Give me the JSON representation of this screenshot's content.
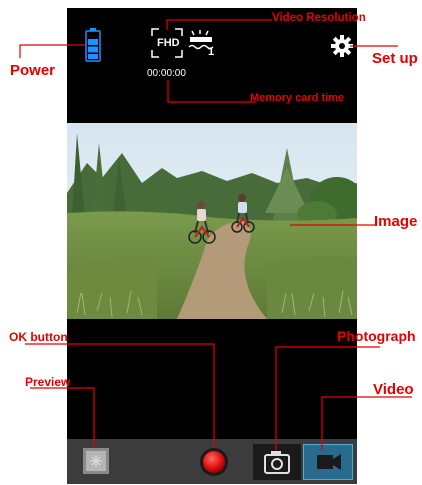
{
  "status": {
    "timer": "00:00:00",
    "resolution": "FHD",
    "white_balance_index": "1"
  },
  "icons": {
    "battery": "battery-icon",
    "resolution": "fhd-resolution-icon",
    "white_balance": "white-balance-icon",
    "settings": "gear-icon",
    "preview": "gallery-thumbnail-icon",
    "record": "record-button-icon",
    "camera": "camera-icon",
    "video": "video-camera-icon"
  },
  "callouts": {
    "power": "Power",
    "video_resolution": "Video Resolution",
    "set_up": "Set up",
    "memory_card_time": "Memory card time",
    "image": "Image",
    "ok_button": "OK button",
    "photograph": "Photograph",
    "preview": "Preview",
    "video": "Video"
  },
  "colors": {
    "callout_red": "#e60000",
    "battery_blue": "#1e90ff",
    "record_red": "#e01010",
    "video_tab_highlight": "#2a6a8c"
  }
}
